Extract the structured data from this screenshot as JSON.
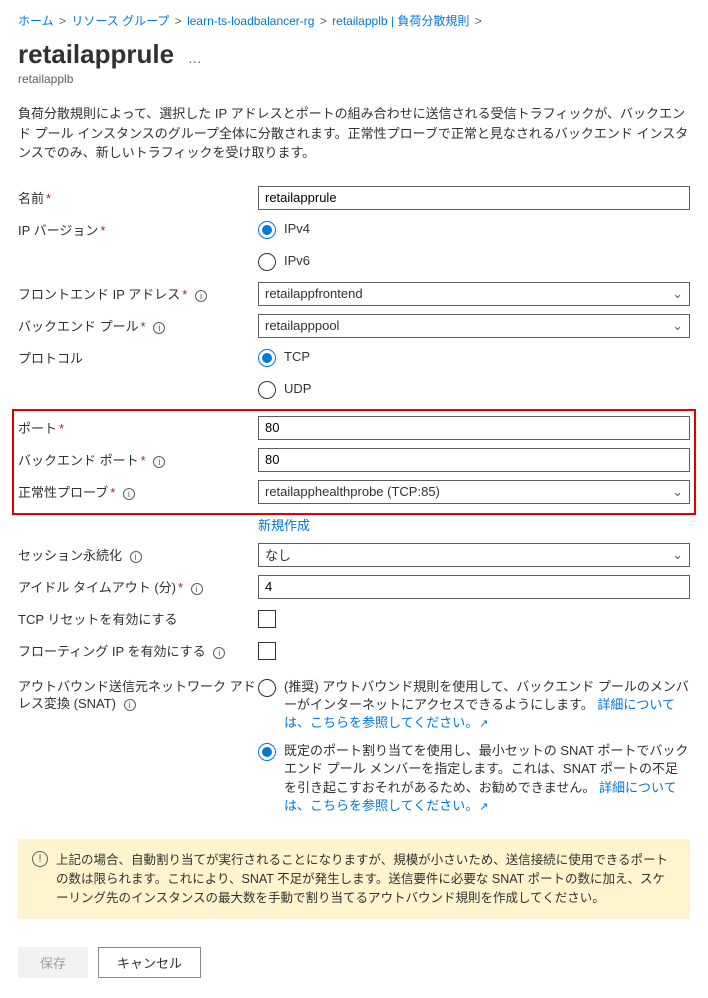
{
  "breadcrumb": {
    "home": "ホーム",
    "rg": "リソース グループ",
    "rgname": "learn-ts-loadbalancer-rg",
    "lb": "retailapplb | 負荷分散規則"
  },
  "title": "retailapprule",
  "subtitle": "retailapplb",
  "description": "負荷分散規則によって、選択した IP アドレスとポートの組み合わせに送信される受信トラフィックが、バックエンド プール インスタンスのグループ全体に分散されます。正常性プローブで正常と見なされるバックエンド インスタンスでのみ、新しいトラフィックを受け取ります。",
  "labels": {
    "name": "名前",
    "ipversion": "IP バージョン",
    "frontend": "フロントエンド IP アドレス",
    "backendpool": "バックエンド プール",
    "protocol": "プロトコル",
    "port": "ポート",
    "backendport": "バックエンド ポート",
    "healthprobe": "正常性プローブ",
    "newcreate": "新規作成",
    "session": "セッション永続化",
    "idle": "アイドル タイムアウト (分)",
    "tcpreset": "TCP リセットを有効にする",
    "floating": "フローティング IP を有効にする",
    "snat": "アウトバウンド送信元ネットワーク アドレス変換 (SNAT)"
  },
  "values": {
    "name": "retailapprule",
    "frontend": "retailappfrontend",
    "backendpool": "retailapppool",
    "port": "80",
    "backendport": "80",
    "healthprobe": "retailapphealthprobe (TCP:85)",
    "session": "なし",
    "idle": "4"
  },
  "radios": {
    "ipv4": "IPv4",
    "ipv6": "IPv6",
    "tcp": "TCP",
    "udp": "UDP"
  },
  "snat": {
    "opt1_a": "(推奨) アウトバウンド規則を使用して、バックエンド プールのメンバーがインターネットにアクセスできるようにします。",
    "opt1_link": "詳細については、こちらを参照してください。",
    "opt2_a": "既定のポート割り当てを使用し、最小セットの SNAT ポートでバックエンド プール メンバーを指定します。これは、SNAT ポートの不足を引き起こすおそれがあるため、お勧めできません。",
    "opt2_link": "詳細については、こちらを参照してください。"
  },
  "warning": "上記の場合、自動割り当てが実行されることになりますが、規模が小さいため、送信接続に使用できるポートの数は限られます。これにより、SNAT 不足が発生します。送信要件に必要な SNAT ポートの数に加え、スケーリング先のインスタンスの最大数を手動で割り当てるアウトバウンド規則を作成してください。",
  "buttons": {
    "save": "保存",
    "cancel": "キャンセル"
  }
}
